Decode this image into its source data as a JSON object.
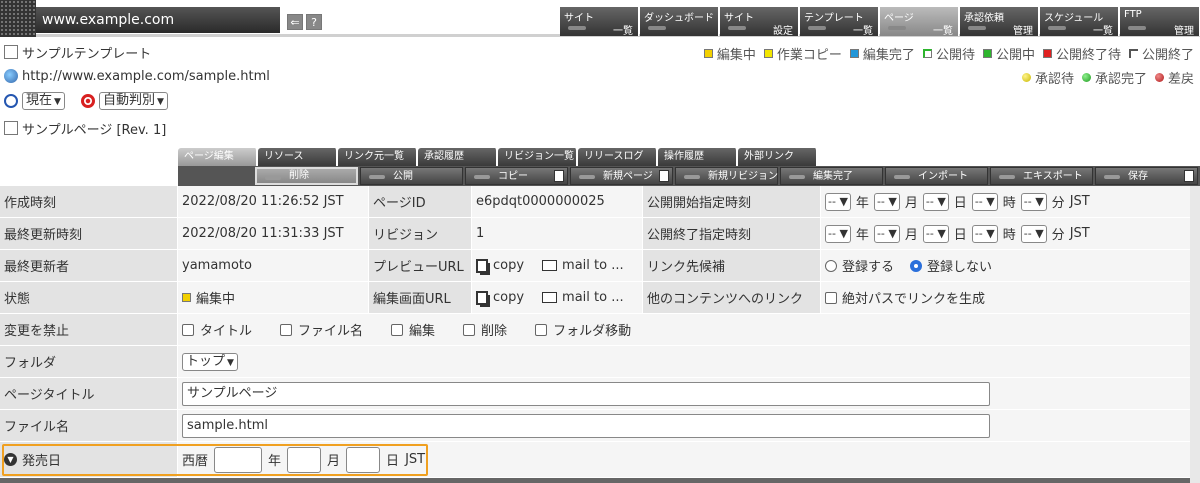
{
  "header": {
    "site_url": "www.example.com",
    "menu": [
      {
        "t1": "サイト",
        "t2": "一覧"
      },
      {
        "t1": "ダッシュボード",
        "t2": ""
      },
      {
        "t1": "サイト",
        "t2": "設定"
      },
      {
        "t1": "テンプレート",
        "t2": "一覧"
      },
      {
        "t1": "ページ",
        "t2": "一覧"
      },
      {
        "t1": "承認依頼",
        "t2": "管理"
      },
      {
        "t1": "スケジュール",
        "t2": "一覧"
      },
      {
        "t1": "FTP",
        "t2": "管理"
      }
    ],
    "help_label": "?"
  },
  "info": {
    "template_name": "サンプルテンプレート",
    "url": "http://www.example.com/sample.html",
    "time_select": "現在",
    "judge_select": "自動判別",
    "page_name": "サンプルページ [Rev. 1]"
  },
  "legend": {
    "squares": [
      {
        "label": "編集中",
        "color": "#f2d000"
      },
      {
        "label": "作業コピー",
        "color": "#f2e600"
      },
      {
        "label": "編集完了",
        "color": "#2196d8"
      },
      {
        "label": "公開待",
        "color": "#2db52d"
      },
      {
        "label": "公開中",
        "color": "#2db52d"
      },
      {
        "label": "公開終了待",
        "color": "#e02020"
      },
      {
        "label": "公開終了",
        "color": "#ffffff"
      }
    ],
    "dots": [
      {
        "label": "承認待",
        "color": "#e6d800"
      },
      {
        "label": "承認完了",
        "color": "#2db52d"
      },
      {
        "label": "差戻",
        "color": "#d02020"
      }
    ]
  },
  "tabs": [
    "ページ編集",
    "リソース",
    "リンク元一覧",
    "承認履歴",
    "リビジョン一覧",
    "リリースログ",
    "操作履歴",
    "外部リンク"
  ],
  "actions": [
    "削除",
    "公開",
    "コピー",
    "新規ページ",
    "新規リビジョン",
    "編集完了",
    "インポート",
    "エキスポート",
    "保存"
  ],
  "form": {
    "created_label": "作成時刻",
    "created_value": "2022/08/20 11:26:52 JST",
    "pageid_label": "ページID",
    "pageid_value": "e6pdqt0000000025",
    "pub_start_label": "公開開始指定時刻",
    "updated_label": "最終更新時刻",
    "updated_value": "2022/08/20 11:31:33 JST",
    "revision_label": "リビジョン",
    "revision_value": "1",
    "pub_end_label": "公開終了指定時刻",
    "updater_label": "最終更新者",
    "updater_value": "yamamoto",
    "preview_label": "プレビューURL",
    "copy_label": "copy",
    "mailto_label": "mail to ...",
    "link_cand_label": "リンク先候補",
    "register_yes": "登録する",
    "register_no": "登録しない",
    "status_label": "状態",
    "status_value": "編集中",
    "editurl_label": "編集画面URL",
    "otherlink_label": "他のコンテンツへのリンク",
    "abspath_label": "絶対パスでリンクを生成",
    "prohibit_label": "変更を禁止",
    "prohibit_opts": [
      "タイトル",
      "ファイル名",
      "編集",
      "削除",
      "フォルダ移動"
    ],
    "folder_label": "フォルダ",
    "folder_value": "トップ",
    "title_label": "ページタイトル",
    "title_value": "サンプルページ",
    "filename_label": "ファイル名",
    "filename_value": "sample.html",
    "release_label": "発売日",
    "era_label": "西暦",
    "date_units": {
      "year": "年",
      "month": "月",
      "day": "日",
      "hour": "時",
      "minute": "分",
      "tz": "JST"
    },
    "dash": "--"
  }
}
